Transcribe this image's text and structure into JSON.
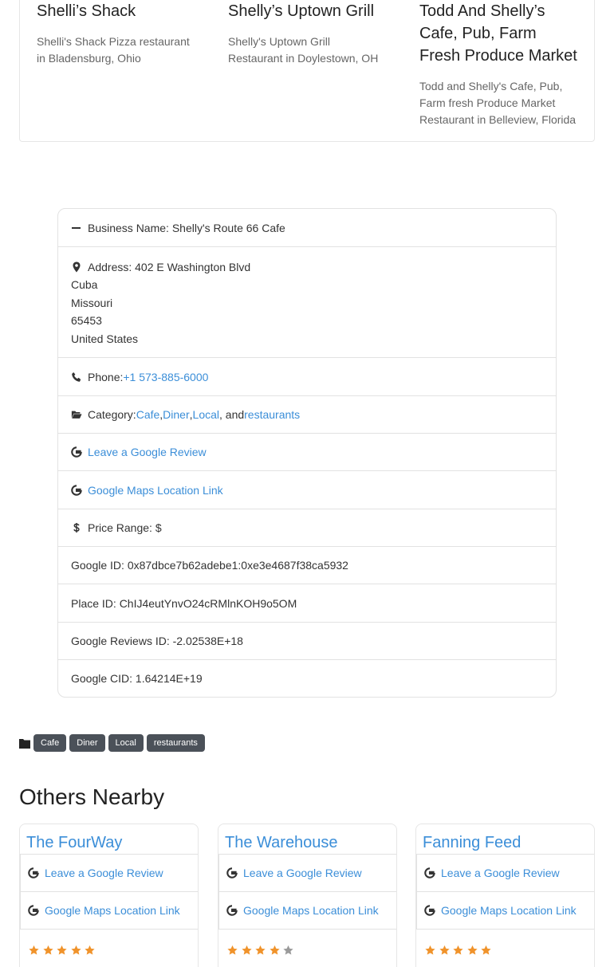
{
  "related": [
    {
      "title": "Shelli’s Shack",
      "desc": "Shelli's Shack Pizza restaurant in Bladensburg, Ohio"
    },
    {
      "title": "Shelly’s Uptown Grill",
      "desc": "Shelly's Uptown Grill Restaurant in Doylestown, OH"
    },
    {
      "title": "Todd And Shelly’s Cafe, Pub, Farm Fresh Produce Market",
      "desc": "Todd and Shelly's Cafe, Pub, Farm fresh Produce Market Restaurant in Belleview, Florida"
    }
  ],
  "details": {
    "business_name": "Business Name: Shelly's Route 66 Cafe",
    "address_label": "Address: 402 E Washington Blvd",
    "address_city": "Cuba",
    "address_state": "Missouri",
    "address_zip": "65453",
    "address_country": "United States",
    "phone_label": "Phone: ",
    "phone_value": "+1 573-885-6000",
    "category_label": "Category: ",
    "categories": [
      "Cafe",
      "Diner",
      "Local",
      "restaurants"
    ],
    "category_sep1": ", ",
    "category_sep2": ", ",
    "category_sep3": ", and ",
    "review_link": "Leave a Google Review",
    "maps_link": "Google Maps Location Link",
    "price_range": "Price Range: $",
    "google_id": "Google ID: 0x87dbce7b62adebe1:0xe3e4687f38ca5932",
    "place_id": "Place ID: ChIJ4eutYnvO24cRMlnKOH9o5OM",
    "reviews_id": "Google Reviews ID: -2.02538E+18",
    "cid": "Google CID: 1.64214E+19"
  },
  "tags": [
    "Cafe",
    "Diner",
    "Local",
    "restaurants"
  ],
  "nearby_title": "Others Nearby",
  "nearby": [
    {
      "name": "The FourWay",
      "review_link": "Leave a Google Review",
      "maps_link": "Google Maps Location Link",
      "rating": 5
    },
    {
      "name": "The Warehouse",
      "review_link": "Leave a Google Review",
      "maps_link": "Google Maps Location Link",
      "rating": 4
    },
    {
      "name": "Fanning Feed",
      "review_link": "Leave a Google Review",
      "maps_link": "Google Maps Location Link",
      "rating": 5
    }
  ],
  "colors": {
    "link": "#3b8ed8",
    "star": "#f0932b",
    "star_empty": "#9a9a9a",
    "tag_bg": "#4b5159"
  }
}
